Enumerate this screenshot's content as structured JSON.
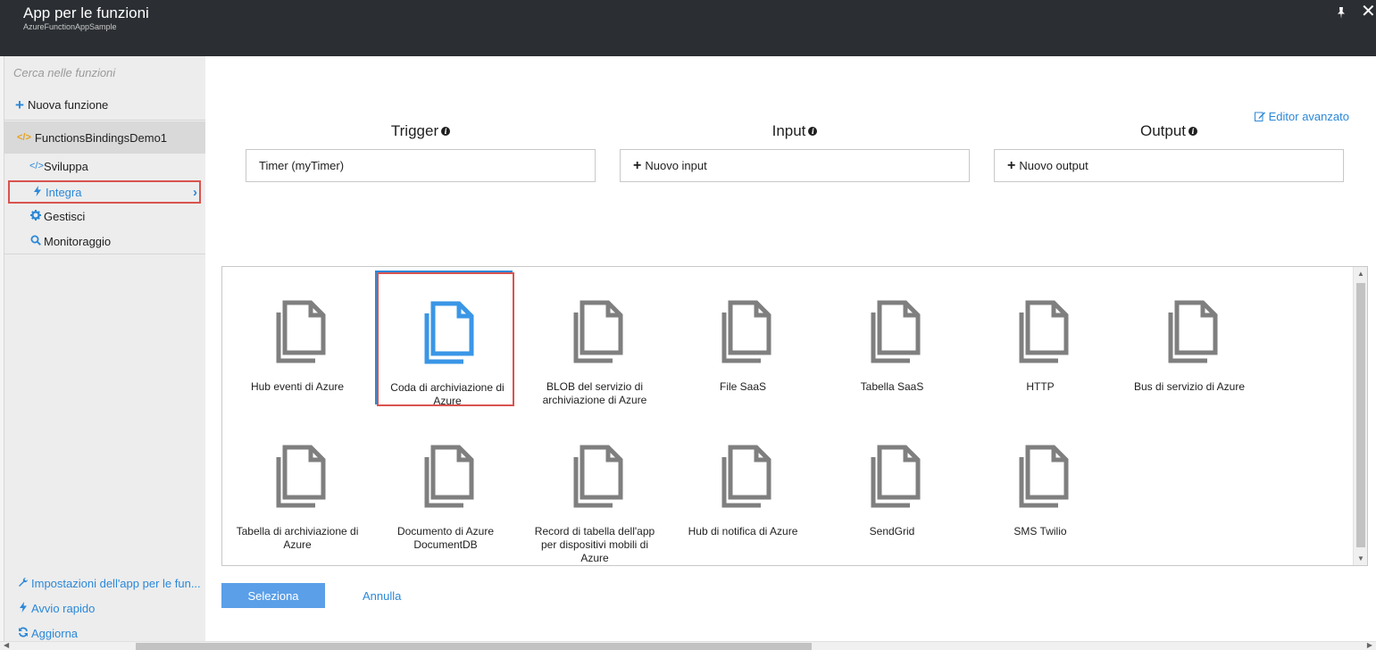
{
  "header": {
    "title": "App per le funzioni",
    "subtitle": "AzureFunctionAppSample"
  },
  "sidebar": {
    "search_placeholder": "Cerca nelle funzioni",
    "new_function": "Nuova funzione",
    "function_name": "FunctionsBindingsDemo1",
    "function_icon": "</>",
    "items": [
      {
        "label": "Sviluppa",
        "icon": "code-icon"
      },
      {
        "label": "Integra",
        "icon": "bolt-icon"
      },
      {
        "label": "Gestisci",
        "icon": "gear-icon"
      },
      {
        "label": "Monitoraggio",
        "icon": "search-icon"
      }
    ],
    "bottom_links": [
      {
        "label": "Impostazioni dell'app per le fun...",
        "icon": "wrench-icon"
      },
      {
        "label": "Avvio rapido",
        "icon": "bolt-icon"
      },
      {
        "label": "Aggiorna",
        "icon": "refresh-icon"
      }
    ]
  },
  "main": {
    "editor_link": "Editor avanzato",
    "columns": [
      {
        "heading": "Trigger",
        "box": "Timer (myTimer)",
        "has_plus": false
      },
      {
        "heading": "Input",
        "box": "Nuovo input",
        "has_plus": true
      },
      {
        "heading": "Output",
        "box": "Nuovo output",
        "has_plus": true
      }
    ],
    "templates": [
      {
        "label": "Hub eventi di Azure",
        "selected": false
      },
      {
        "label": "Coda di archiviazione di Azure",
        "selected": true
      },
      {
        "label": "BLOB del servizio di archiviazione di Azure",
        "selected": false
      },
      {
        "label": "File SaaS",
        "selected": false
      },
      {
        "label": "Tabella SaaS",
        "selected": false
      },
      {
        "label": "HTTP",
        "selected": false
      },
      {
        "label": "Bus di servizio di Azure",
        "selected": false
      },
      {
        "label": "Tabella di archiviazione di Azure",
        "selected": false
      },
      {
        "label": "Documento di Azure DocumentDB",
        "selected": false
      },
      {
        "label": "Record di tabella dell'app per dispositivi mobili di Azure",
        "selected": false
      },
      {
        "label": "Hub di notifica di Azure",
        "selected": false
      },
      {
        "label": "SendGrid",
        "selected": false
      },
      {
        "label": "SMS Twilio",
        "selected": false
      }
    ],
    "select_button": "Seleziona",
    "cancel_link": "Annulla"
  },
  "colors": {
    "header_bg": "#2b2f33",
    "accent": "#2b88d8",
    "highlight": "#d9534f",
    "icon_gray": "#7f7f7f",
    "icon_selected": "#3a96e6"
  }
}
